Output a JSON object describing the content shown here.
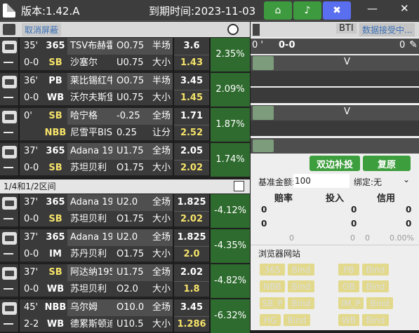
{
  "title_bar": {
    "version": "版本:1.42.A",
    "expiry": "到期时间:2023-11-03",
    "close": "✕",
    "minimize": "—"
  },
  "toolbar": {
    "cancel_block": "取消屏蔽",
    "bti": "BTI",
    "receiving": "数据接受中..."
  },
  "matches_top": [
    {
      "time": "35'",
      "score": "0-0",
      "book1": "365",
      "book1_style": "w",
      "book2": "SB",
      "book2_style": "y",
      "team1": "TSV布赫霍",
      "team2": "沙塞尔",
      "line1": "O0.75",
      "line2": "U0.75",
      "type1": "半场",
      "type2": "大小",
      "odds1": "3.6",
      "odds2": "1.43",
      "pct": "2.35%"
    },
    {
      "time": "36'",
      "score": "0-0",
      "book1": "PB",
      "book1_style": "w",
      "book2": "WB",
      "book2_style": "w",
      "team1": "莱比锡红牛",
      "team2": "沃尔夫斯堡",
      "line1": "O0.75",
      "line2": "U0.75",
      "type1": "半场",
      "type2": "大小",
      "odds1": "3.45",
      "odds2": "1.45",
      "pct": "2.09%"
    },
    {
      "time": "0'",
      "score": "",
      "book1": "SB",
      "book1_style": "y",
      "book2": "NBB",
      "book2_style": "y",
      "team1": "哈宁格",
      "team2": "尼雪平BIS",
      "line1": "-0.25",
      "line2": "0.25",
      "type1": "全场",
      "type2": "让分",
      "odds1": "1.71",
      "odds2": "2.52",
      "pct": "1.87%"
    },
    {
      "time": "37'",
      "score": "0-0",
      "book1": "365",
      "book1_style": "w",
      "book2": "SB",
      "book2_style": "y",
      "team1": "Adana 19",
      "team2": "苏坦贝利",
      "line1": "U1.75",
      "line2": "O1.75",
      "type1": "全场",
      "type2": "大小",
      "odds1": "2.05",
      "odds2": "2.02",
      "pct": "1.74%"
    }
  ],
  "section2": {
    "label": "1/4和1/2区间"
  },
  "matches_bottom": [
    {
      "time": "37'",
      "score": "0-0",
      "book1": "365",
      "book1_style": "w",
      "book2": "SB",
      "book2_style": "y",
      "team1": "Adana 19",
      "team2": "苏坦贝利",
      "line1": "U2.0",
      "line2": "O1.75",
      "type1": "全场",
      "type2": "大小",
      "odds1": "1.825",
      "odds2": "2.02",
      "pct": "-4.12%"
    },
    {
      "time": "37'",
      "score": "0-0",
      "book1": "365",
      "book1_style": "w",
      "book2": "IM",
      "book2_style": "w",
      "team1": "Adana 19",
      "team2": "苏丹贝利",
      "line1": "U2.0",
      "line2": "O1.75",
      "type1": "全场",
      "type2": "大小",
      "odds1": "1.825",
      "odds2": "2.0",
      "pct": "-4.35%"
    },
    {
      "time": "37'",
      "score": "0-0",
      "book1": "SB",
      "book1_style": "y",
      "book2": "WB",
      "book2_style": "w",
      "team1": "阿达纳195",
      "team2": "苏坦贝利",
      "line1": "U1.75",
      "line2": "O2.0",
      "type1": "全场",
      "type2": "大小",
      "odds1": "2.02",
      "odds2": "1.8",
      "pct": "-4.82%"
    },
    {
      "time": "45'",
      "score": "2-2",
      "book1": "NBB",
      "book1_style": "w",
      "book2": "WB",
      "book2_style": "w",
      "team1": "乌尔姆",
      "team2": "德累斯顿迪",
      "line1": "O10.0",
      "line2": "U10.5",
      "type1": "全场",
      "type2": "大小",
      "odds1": "3.45",
      "odds2": "1.286",
      "pct": "-6.32%"
    }
  ],
  "right_panel": {
    "time": "0 '",
    "score": "0-0",
    "v1": "V",
    "v2": "V",
    "btn_both": "双边补投",
    "btn_restore": "复原",
    "base_amount_label": "基准金额:",
    "base_amount_value": "100",
    "bind_label": "绑定:",
    "bind_value": "无",
    "col_odds": "赔率",
    "col_stake": "投入",
    "col_credit": "信用",
    "r1": [
      "0",
      "0",
      "0"
    ],
    "r2": [
      "0",
      "0",
      "0"
    ],
    "r3": [
      "0",
      "0",
      "0",
      "0.00%"
    ],
    "browser_label": "浏览器网站",
    "bind_buttons": [
      [
        "365",
        "Bind"
      ],
      [
        "PB",
        "Bind"
      ],
      [
        "NBB",
        "Bind"
      ],
      [
        "OB",
        "Bind"
      ],
      [
        "SB_P",
        "Bind"
      ],
      [
        "IM_P",
        "Bind"
      ],
      [
        "HG",
        "Bind"
      ],
      [
        "WB",
        "Bind"
      ]
    ]
  }
}
